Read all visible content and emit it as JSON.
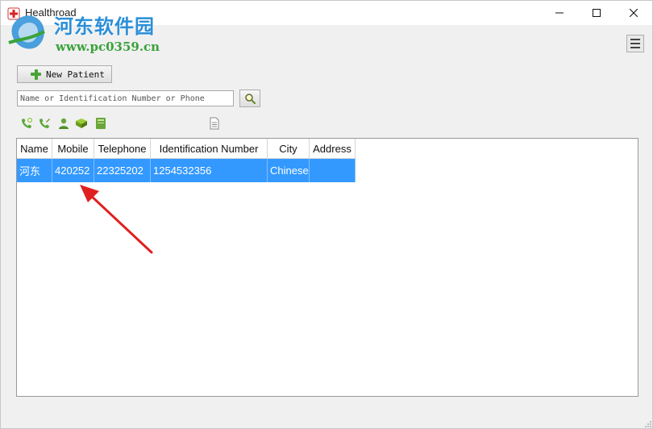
{
  "window": {
    "title": "Healthroad",
    "accent_color": "#3399ff"
  },
  "watermark": {
    "text_cn": "河东软件园",
    "url": "www.pc0359.cn"
  },
  "toolbar": {
    "new_patient_label": "New Patient",
    "search_placeholder": "Name or Identification Number or Phone",
    "search_value": "",
    "icons": [
      "call-add-icon",
      "call-edit-icon",
      "user-icon",
      "book-icon",
      "notebook-icon",
      "document-icon"
    ]
  },
  "table": {
    "columns": [
      "Name",
      "Mobile",
      "Telephone",
      "Identification Number",
      "City",
      "Address"
    ],
    "rows": [
      [
        "河东",
        "420252",
        "22325202",
        "1254532356",
        "Chinese",
        ""
      ]
    ]
  }
}
